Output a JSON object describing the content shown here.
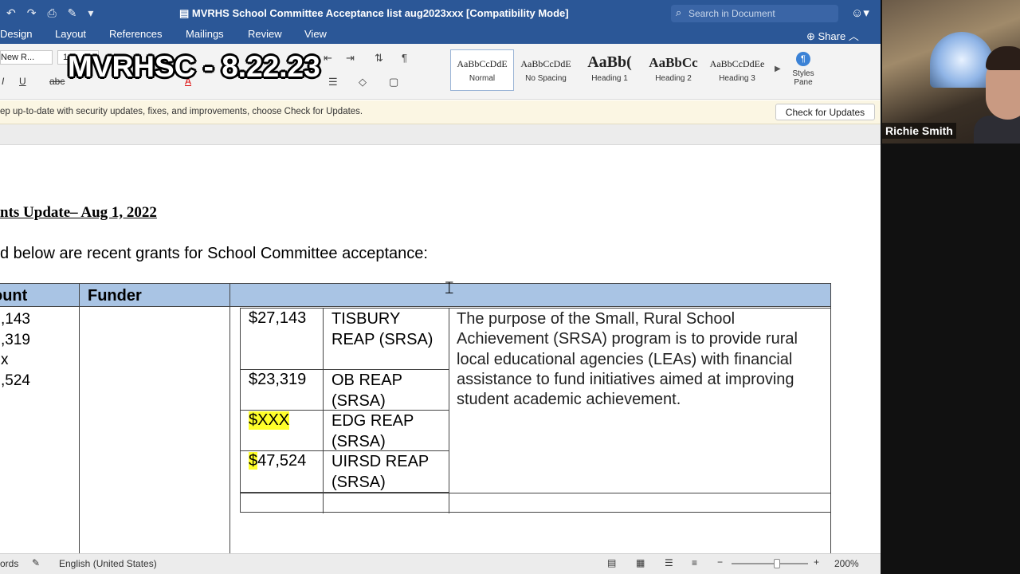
{
  "app": {
    "window_title": "MVRHS School Committee Acceptance list aug2023xxx [Compatibility Mode]",
    "search_placeholder": "Search in Document"
  },
  "menu": {
    "tabs": [
      "Design",
      "Layout",
      "References",
      "Mailings",
      "Review",
      "View"
    ],
    "share_label": "Share"
  },
  "ribbon": {
    "font_name": "New R...",
    "font_size": "1",
    "styles": [
      {
        "sample": "AaBbCcDdE",
        "name": "Normal",
        "selected": true
      },
      {
        "sample": "AaBbCcDdE",
        "name": "No Spacing"
      },
      {
        "sample": "AaBb(",
        "name": "Heading 1"
      },
      {
        "sample": "AaBbCc",
        "name": "Heading 2"
      },
      {
        "sample": "AaBbCcDdEe",
        "name": "Heading 3"
      }
    ],
    "styles_pane_label": "Styles Pane"
  },
  "overlay": {
    "meeting_tag": "MVRHSC - 8.22.23"
  },
  "update_bar": {
    "message": "ep up-to-date with security updates, fixes, and improvements, choose Check for Updates.",
    "button": "Check for Updates"
  },
  "document": {
    "heading": "nts Update– Aug 1, 2022",
    "intro": "d below are recent grants for School Committee acceptance:",
    "table": {
      "header": [
        "ount",
        "Funder",
        ""
      ],
      "amount_column": [
        ",143",
        ",319",
        "x",
        ",524"
      ],
      "inner_rows": [
        {
          "amount": "$27,143",
          "name": "TISBURY REAP (SRSA)",
          "highlight": false
        },
        {
          "amount": "$23,319",
          "name": "OB REAP (SRSA)",
          "highlight": false
        },
        {
          "amount": "$XXX",
          "name": "EDG REAP (SRSA)",
          "highlight": true
        },
        {
          "amount_highlight": "$",
          "amount": "47,524",
          "name": "UIRSD REAP (SRSA)",
          "highlight": "partial"
        }
      ],
      "purpose": "The purpose of the Small, Rural School Achievement (SRSA) program is to provide rural local educational agencies (LEAs) with financial assistance to fund initiatives aimed at improving student academic achievement."
    }
  },
  "status_bar": {
    "words": "ords",
    "language": "English (United States)",
    "zoom": "200%",
    "zoom_fraction": 0.6
  },
  "video": {
    "participant_name": "Richie Smith"
  }
}
